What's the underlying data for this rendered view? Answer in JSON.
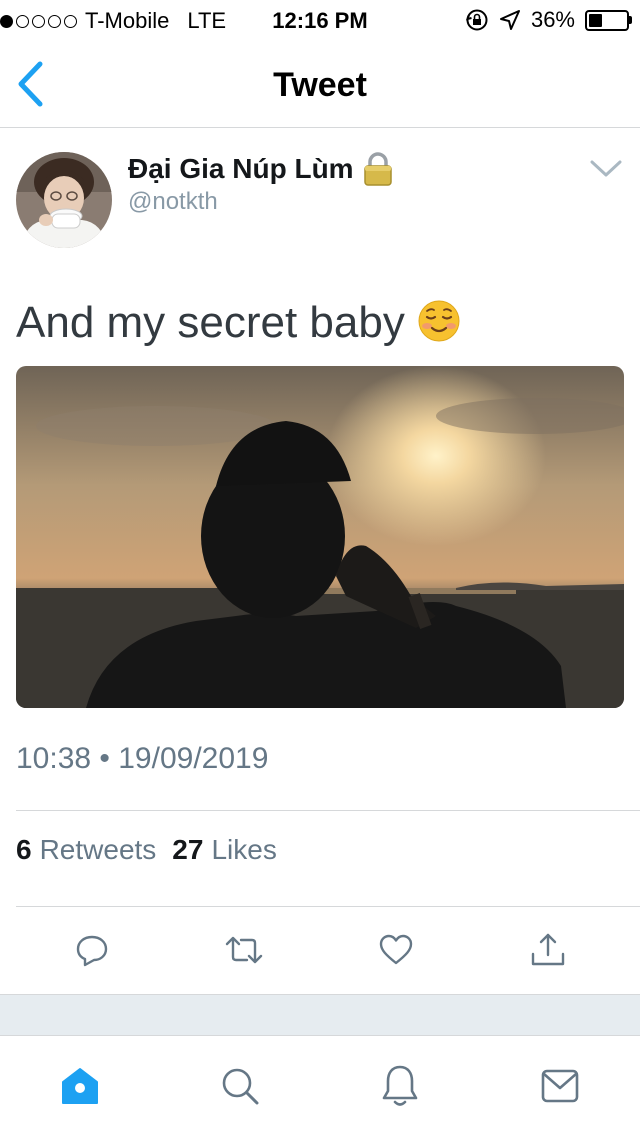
{
  "status_bar": {
    "carrier": "T-Mobile",
    "network": "LTE",
    "time": "12:16 PM",
    "battery": "36%",
    "battery_level": 0.36,
    "signal_bars": 1
  },
  "nav": {
    "title": "Tweet",
    "back_icon": "chevron-left-icon"
  },
  "tweet": {
    "author": {
      "display_name": "Đại Gia Núp Lùm",
      "handle": "@notkth",
      "protected_icon": "lock-icon"
    },
    "text": "And my secret baby",
    "text_emoji": "smiling-face-icon",
    "media_description": "photo",
    "timestamp": "10:38 • 19/09/2019",
    "stats": {
      "retweets_count": "6",
      "retweets_label": "Retweets",
      "likes_count": "27",
      "likes_label": "Likes"
    },
    "actions": [
      "reply-icon",
      "retweet-icon",
      "like-icon",
      "share-icon"
    ]
  },
  "tab_bar": {
    "tabs": [
      "home-icon",
      "search-icon",
      "notifications-icon",
      "messages-icon"
    ],
    "active": "home-icon"
  },
  "colors": {
    "accent": "#1da1f2",
    "icon_gray": "#657786",
    "secondary_text": "#8899a6",
    "divider": "#d6d8da",
    "band": "#e6ecf0"
  }
}
